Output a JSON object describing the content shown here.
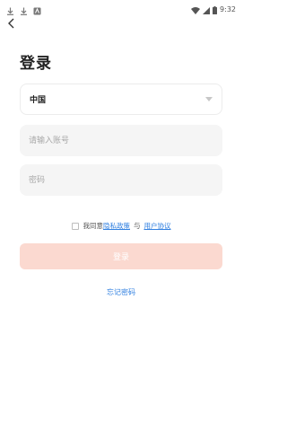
{
  "status_bar": {
    "time": "9:32",
    "left_icons": [
      "download-icon",
      "download-icon",
      "app-notification-icon"
    ],
    "right_icons": [
      "wifi-icon",
      "signal-icon",
      "battery-icon"
    ]
  },
  "header": {
    "back_icon": "chevron-left-icon",
    "title": "登录"
  },
  "form": {
    "country": "中国",
    "account_placeholder": "请输入账号",
    "account_value": "",
    "password_placeholder": "密码",
    "password_value": ""
  },
  "agreement": {
    "prefix": "我同意",
    "privacy_link": "隐私政策",
    "and": "与",
    "user_link": "用户协议",
    "checked": false
  },
  "login_button": {
    "label": "登录",
    "enabled": false
  },
  "forgot_password": "忘记密码",
  "colors": {
    "accent": "#2f7fe0",
    "button_disabled": "#fbd9d0",
    "input_bg": "#f5f5f5"
  }
}
